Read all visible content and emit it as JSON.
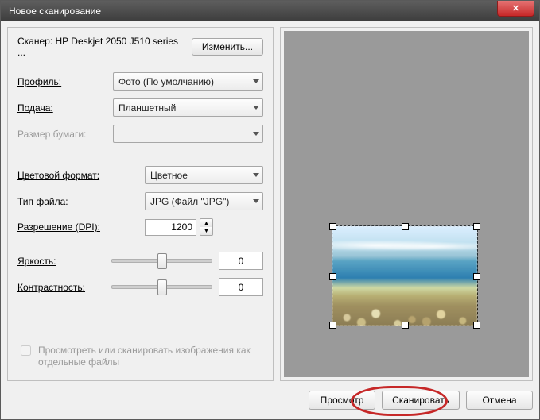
{
  "window": {
    "title": "Новое сканирование"
  },
  "scanner": {
    "label": "Сканер:",
    "name": "HP Deskjet 2050 J510 series ...",
    "change_btn": "Изменить..."
  },
  "fields": {
    "profile": {
      "label": "Профиль:",
      "value": "Фото (По умолчанию)"
    },
    "feed": {
      "label": "Подача:",
      "value": "Планшетный"
    },
    "paper": {
      "label": "Размер бумаги:",
      "value": ""
    },
    "color": {
      "label": "Цветовой формат:",
      "value": "Цветное"
    },
    "filetype": {
      "label": "Тип файла:",
      "value": "JPG (Файл \"JPG\")"
    },
    "dpi": {
      "label": "Разрешение (DPI):",
      "value": "1200"
    },
    "brightness": {
      "label": "Яркость:",
      "value": "0"
    },
    "contrast": {
      "label": "Контрастность:",
      "value": "0"
    }
  },
  "checkbox": {
    "label": "Просмотреть или сканировать изображения как отдельные файлы"
  },
  "footer": {
    "preview": "Просмотр",
    "scan": "Сканировать",
    "cancel": "Отмена"
  }
}
